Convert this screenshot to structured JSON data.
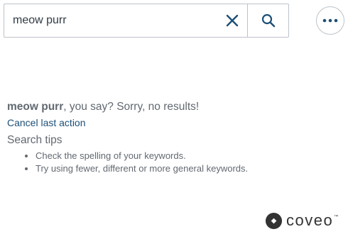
{
  "search": {
    "value": "meow purr",
    "placeholder": "",
    "clear_icon": "close-icon",
    "search_icon": "search-icon",
    "more_icon": "ellipsis-icon"
  },
  "no_results": {
    "query": "meow purr",
    "message": ", you say? Sorry, no results!",
    "cancel_label": "Cancel last action",
    "tips_title": "Search tips",
    "tips": [
      "Check the spelling of your keywords.",
      "Try using fewer, different or more general keywords."
    ]
  },
  "branding": {
    "logo_text": "coveo",
    "trademark": "™"
  },
  "colors": {
    "text": "#626971",
    "link": "#1d4f76",
    "icon": "#1d4f76",
    "border": "#bcc3ca"
  }
}
